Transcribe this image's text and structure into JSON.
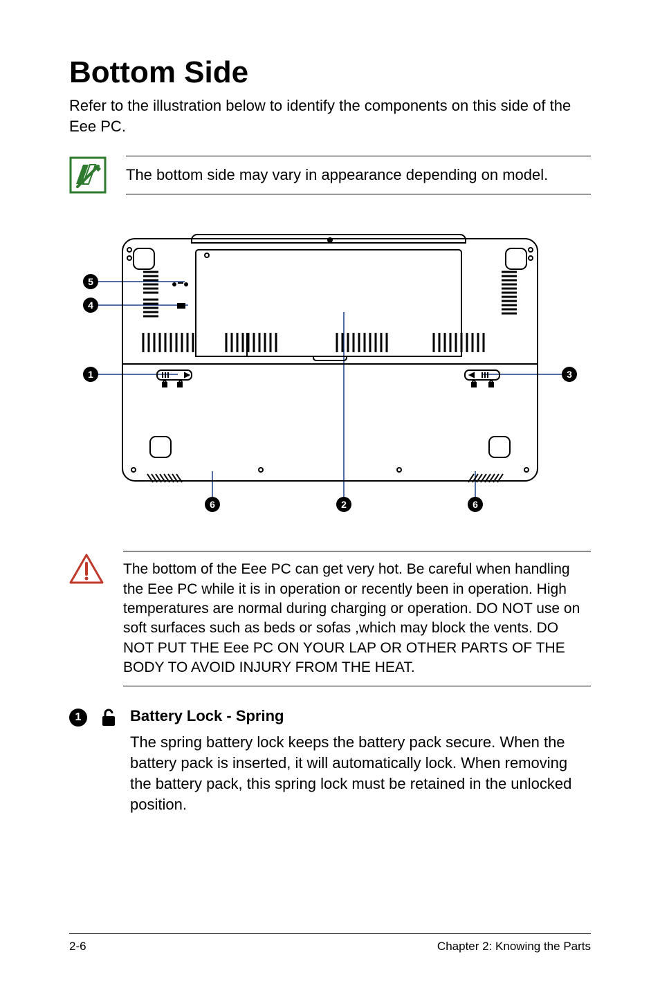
{
  "title": "Bottom Side",
  "intro": "Refer to the illustration below to identify the components on this side of the Eee PC.",
  "note": "The bottom side may vary in appearance depending on model.",
  "warning": "The bottom of the Eee PC can get very hot. Be careful when handling the Eee PC while it is in operation or recently been in operation. High temperatures are normal during charging or operation. DO NOT use on soft surfaces such as beds or sofas ,which may block the vents. DO NOT PUT THE Eee PC ON YOUR LAP OR OTHER PARTS OF THE BODY TO AVOID INJURY FROM THE HEAT.",
  "item1": {
    "number": "1",
    "heading": "Battery Lock - Spring",
    "text": "The spring battery lock keeps the battery pack secure. When the battery pack is inserted, it will automatically lock. When removing the battery pack, this spring lock must be retained in the unlocked position."
  },
  "callouts": {
    "c1": "1",
    "c2": "2",
    "c3": "3",
    "c4": "4",
    "c5": "5",
    "c6": "6"
  },
  "footer": {
    "left": "2-6",
    "right": "Chapter 2: Knowing the Parts"
  }
}
